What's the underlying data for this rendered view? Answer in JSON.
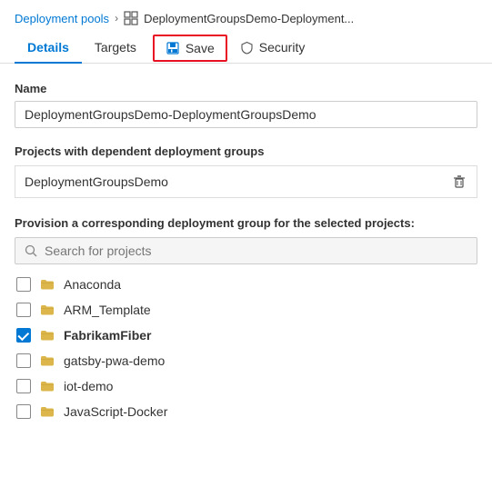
{
  "breadcrumb": {
    "parent": "Deployment pools",
    "separator": "›",
    "current": "DeploymentGroupsDemo-Deployment..."
  },
  "tabs": [
    {
      "id": "details",
      "label": "Details",
      "active": true
    },
    {
      "id": "targets",
      "label": "Targets",
      "active": false
    }
  ],
  "save_button": {
    "label": "Save"
  },
  "security_tab": {
    "label": "Security"
  },
  "name_field": {
    "label": "Name",
    "value": "DeploymentGroupsDemo-DeploymentGroupsDemo"
  },
  "dependent_section": {
    "title": "Projects with dependent deployment groups",
    "project": "DeploymentGroupsDemo"
  },
  "provision_section": {
    "title": "Provision a corresponding deployment group for the selected projects:",
    "search_placeholder": "Search for projects"
  },
  "projects": [
    {
      "id": "anaconda",
      "name": "Anaconda",
      "checked": false
    },
    {
      "id": "arm_template",
      "name": "ARM_Template",
      "checked": false
    },
    {
      "id": "fabrikamfiber",
      "name": "FabrikamFiber",
      "checked": true,
      "highlighted": true
    },
    {
      "id": "gatsby-pwa-demo",
      "name": "gatsby-pwa-demo",
      "checked": false
    },
    {
      "id": "iot-demo",
      "name": "iot-demo",
      "checked": false
    },
    {
      "id": "javascript-docker",
      "name": "JavaScript-Docker",
      "checked": false
    }
  ]
}
